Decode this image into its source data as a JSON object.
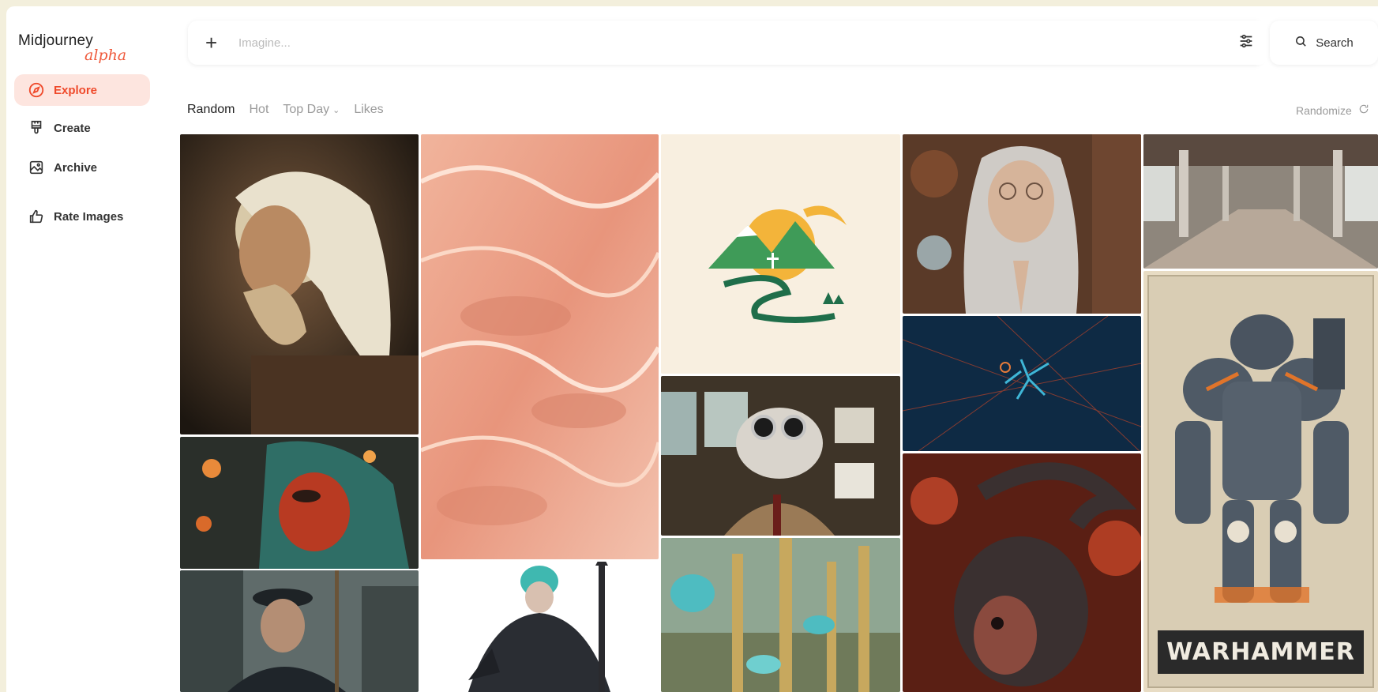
{
  "app": {
    "logo": "Midjourney",
    "logo_badge": "alpha"
  },
  "sidebar": {
    "items": [
      {
        "label": "Explore",
        "icon": "compass-icon",
        "active": true
      },
      {
        "label": "Create",
        "icon": "paintbrush-icon",
        "active": false
      },
      {
        "label": "Archive",
        "icon": "image-archive-icon",
        "active": false
      },
      {
        "label": "Rate Images",
        "icon": "thumbs-up-icon",
        "active": false
      }
    ]
  },
  "prompt": {
    "placeholder": "Imagine...",
    "value": ""
  },
  "search": {
    "label": "Search"
  },
  "tabs": [
    {
      "label": "Random",
      "active": true
    },
    {
      "label": "Hot",
      "active": false
    },
    {
      "label": "Top Day",
      "active": false,
      "dropdown": true
    },
    {
      "label": "Likes",
      "active": false
    }
  ],
  "randomize": {
    "label": "Randomize"
  },
  "gallery": {
    "warhammer_text": "WARHAMMER"
  },
  "colors": {
    "accent": "#ef4a2b",
    "accent_bg": "#fde5df"
  }
}
